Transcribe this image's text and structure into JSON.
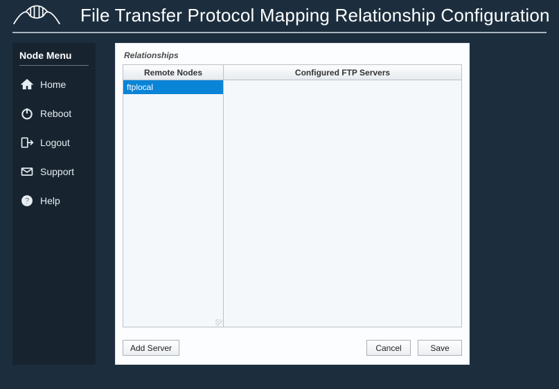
{
  "header": {
    "title": "File Transfer Protocol Mapping Relationship Configuration"
  },
  "sidebar": {
    "title": "Node Menu",
    "items": [
      {
        "label": "Home"
      },
      {
        "label": "Reboot"
      },
      {
        "label": "Logout"
      },
      {
        "label": "Support"
      },
      {
        "label": "Help"
      }
    ]
  },
  "panel": {
    "title": "Relationships",
    "columns": {
      "remote_label": "Remote Nodes",
      "servers_label": "Configured FTP Servers"
    },
    "remote_nodes": [
      {
        "label": "ftplocal",
        "selected": true
      }
    ],
    "ftp_servers": []
  },
  "buttons": {
    "add_server": "Add Server",
    "cancel": "Cancel",
    "save": "Save"
  }
}
